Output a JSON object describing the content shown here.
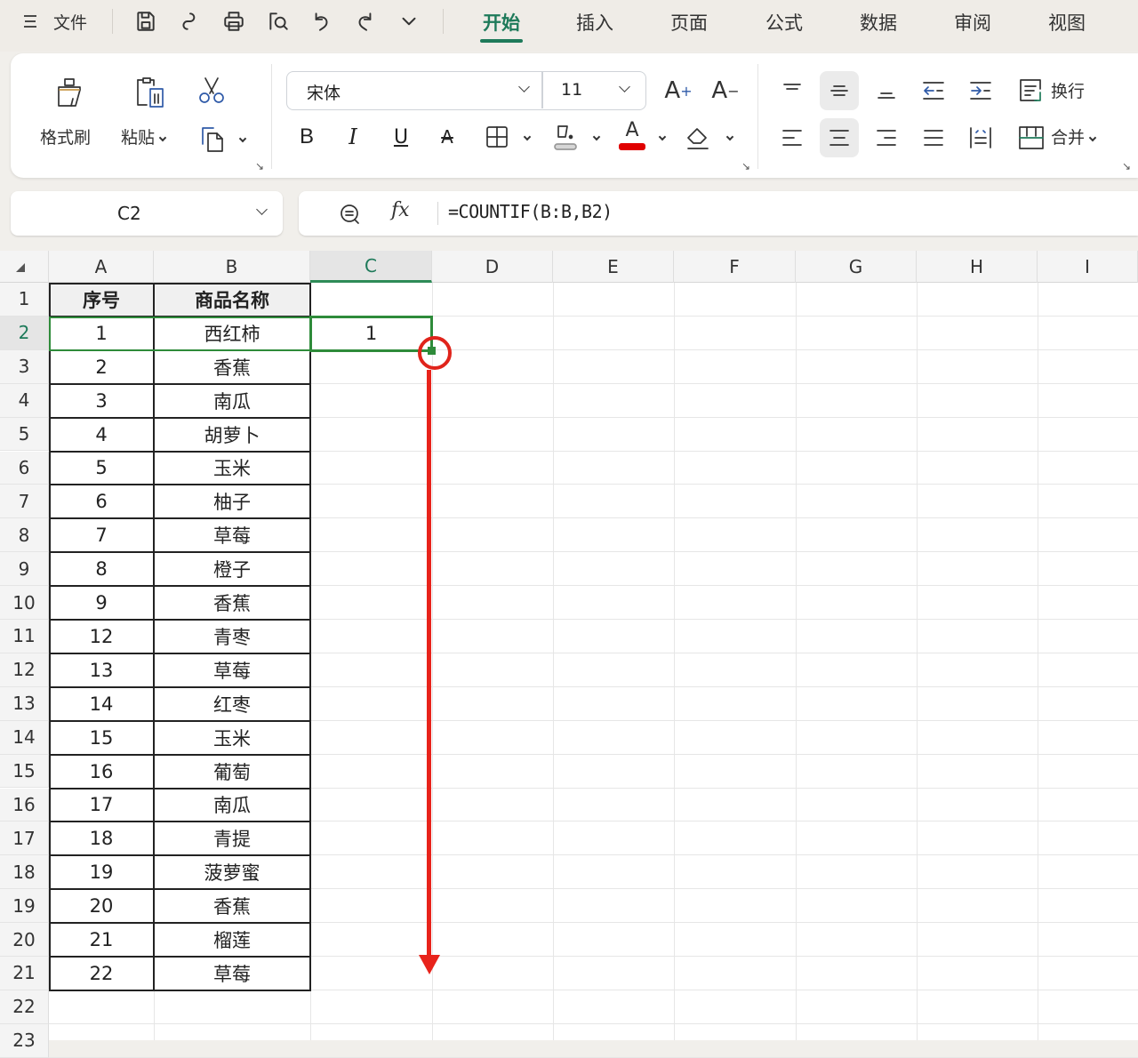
{
  "topbar": {
    "menu_icon": "hamburger-icon",
    "file_label": "文件",
    "quick_icons": [
      "save-icon",
      "link-icon",
      "print-icon",
      "print-preview-icon",
      "undo-icon",
      "redo-icon",
      "more-chevron-icon"
    ],
    "tabs": [
      {
        "label": "开始",
        "active": true
      },
      {
        "label": "插入",
        "active": false
      },
      {
        "label": "页面",
        "active": false
      },
      {
        "label": "公式",
        "active": false
      },
      {
        "label": "数据",
        "active": false
      },
      {
        "label": "审阅",
        "active": false
      },
      {
        "label": "视图",
        "active": false
      }
    ],
    "accent_color": "#1e7a5a"
  },
  "ribbon": {
    "clipboard": {
      "format_painter_label": "格式刷",
      "paste_label": "粘贴",
      "cut_icon": "scissors-icon",
      "copy_icon": "copy-icon"
    },
    "font": {
      "font_name": "宋体",
      "font_size": "11",
      "increase_font_icon": "A+",
      "decrease_font_icon": "A-",
      "bold_label": "B",
      "italic_label": "I",
      "underline_label": "U",
      "strikethrough_label": "A",
      "font_color_label": "A",
      "font_color": "#e00000",
      "fill_color": "#d0d0d0"
    },
    "alignment": {
      "wrap_label": "换行",
      "merge_label": "合并"
    }
  },
  "formula_bar": {
    "name_box": "C2",
    "fx_label": "fx",
    "formula": "=COUNTIF(B:B,B2)"
  },
  "sheet": {
    "columns": [
      "A",
      "B",
      "C",
      "D",
      "E",
      "F",
      "G",
      "H",
      "I"
    ],
    "selected_column": "C",
    "selected_row": "2",
    "row_numbers": [
      "1",
      "2",
      "3",
      "4",
      "5",
      "6",
      "7",
      "8",
      "9",
      "10",
      "11",
      "12",
      "13",
      "14",
      "15",
      "16",
      "17",
      "18",
      "19",
      "20",
      "21",
      "22",
      "23"
    ],
    "header": {
      "a": "序号",
      "b": "商品名称",
      "c": ""
    },
    "rows": [
      {
        "a": "1",
        "b": "西红柿",
        "c": "1"
      },
      {
        "a": "2",
        "b": "香蕉",
        "c": ""
      },
      {
        "a": "3",
        "b": "南瓜",
        "c": ""
      },
      {
        "a": "4",
        "b": "胡萝卜",
        "c": ""
      },
      {
        "a": "5",
        "b": "玉米",
        "c": ""
      },
      {
        "a": "6",
        "b": "柚子",
        "c": ""
      },
      {
        "a": "7",
        "b": "草莓",
        "c": ""
      },
      {
        "a": "8",
        "b": "橙子",
        "c": ""
      },
      {
        "a": "9",
        "b": "香蕉",
        "c": ""
      },
      {
        "a": "12",
        "b": "青枣",
        "c": ""
      },
      {
        "a": "13",
        "b": "草莓",
        "c": ""
      },
      {
        "a": "14",
        "b": "红枣",
        "c": ""
      },
      {
        "a": "15",
        "b": "玉米",
        "c": ""
      },
      {
        "a": "16",
        "b": "葡萄",
        "c": ""
      },
      {
        "a": "17",
        "b": "南瓜",
        "c": ""
      },
      {
        "a": "18",
        "b": "青提",
        "c": ""
      },
      {
        "a": "19",
        "b": "菠萝蜜",
        "c": ""
      },
      {
        "a": "20",
        "b": "香蕉",
        "c": ""
      },
      {
        "a": "21",
        "b": "榴莲",
        "c": ""
      },
      {
        "a": "22",
        "b": "草莓",
        "c": ""
      }
    ],
    "selection_color": "#2e8b3a",
    "annotation_color": "#e8231b"
  }
}
